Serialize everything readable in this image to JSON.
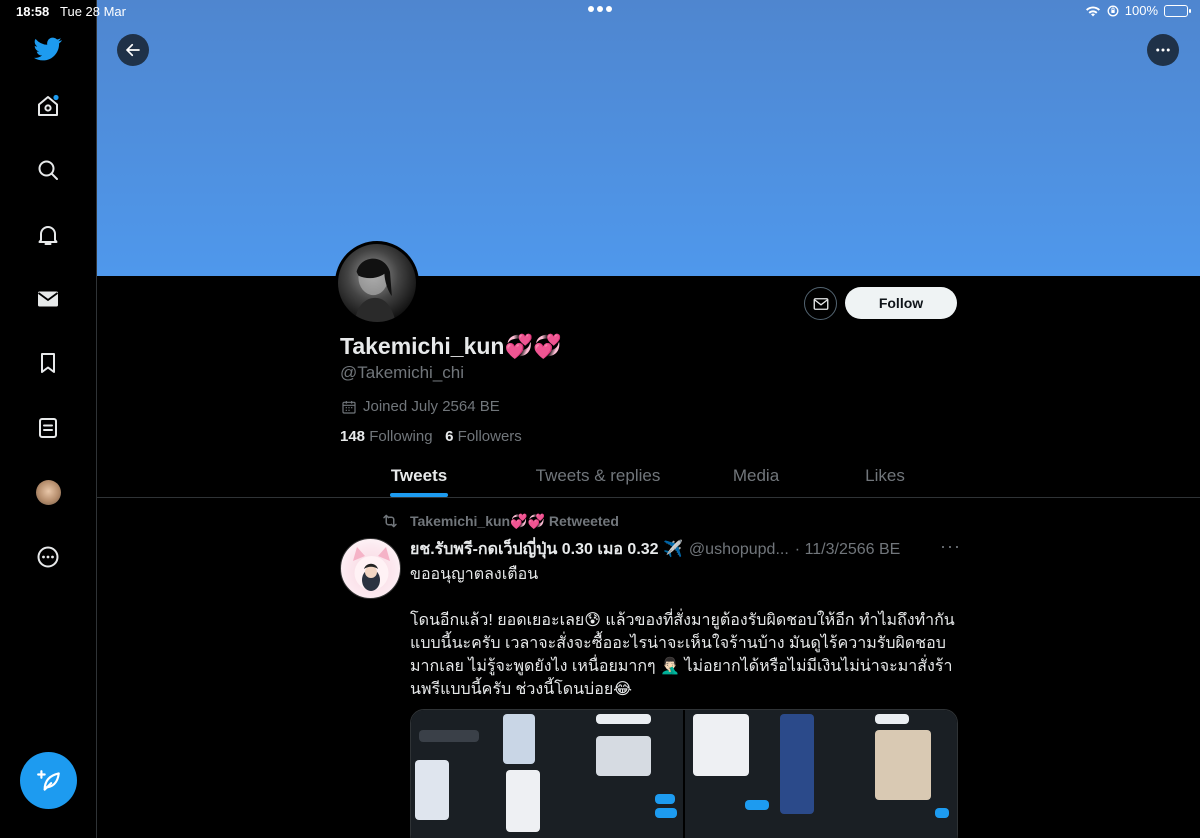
{
  "status_bar": {
    "time": "18:58",
    "date": "Tue 28 Mar",
    "battery": "100%"
  },
  "sidebar": {
    "items": [
      {
        "name": "home",
        "icon": "home-icon"
      },
      {
        "name": "explore",
        "icon": "search-icon"
      },
      {
        "name": "notifications",
        "icon": "bell-icon"
      },
      {
        "name": "messages",
        "icon": "mail-icon"
      },
      {
        "name": "bookmarks",
        "icon": "bookmark-icon"
      },
      {
        "name": "lists",
        "icon": "list-icon"
      },
      {
        "name": "profile",
        "icon": "avatar-icon"
      },
      {
        "name": "more",
        "icon": "more-circle-icon"
      }
    ],
    "compose_icon": "compose-tweet-icon"
  },
  "profile": {
    "display_name": "Takemichi_kun💞💞",
    "handle": "@Takemichi_chi",
    "joined": "Joined July 2564 BE",
    "following_count": "148",
    "following_label": "Following",
    "followers_count": "6",
    "followers_label": "Followers",
    "follow_button": "Follow"
  },
  "tabs": [
    {
      "label": "Tweets",
      "active": true
    },
    {
      "label": "Tweets & replies",
      "active": false
    },
    {
      "label": "Media",
      "active": false
    },
    {
      "label": "Likes",
      "active": false
    }
  ],
  "tweet": {
    "retweeted_by": "Takemichi_kun💞💞 Retweeted",
    "author_name": "ยช.รับพรี-กดเว็ปญี่ปุ่น 0.30 เมอ 0.32 ✈️",
    "author_handle": "@ushopupd...",
    "date": "· 11/3/2566 BE",
    "more": "···",
    "text_line1": "ขออนุญาตลงเตือน",
    "text_line2": "โดนอีกแล้ว! ยอดเยอะเลย😰 แล้วของที่สั่งมายูต้องรับผิดชอบให้อีก ทำไมถึงทำกันแบบนี้นะครับ เวลาจะสั่งจะซื้ออะไรน่าจะเห็นใจร้านบ้าง มันดูไร้ความรับผิดชอบมากเลย ไม่รู้จะพูดยังไง เหนื่อยมากๆ 🤦🏻‍♂️ ไม่อยากได้หรือไม่มีเงินไม่น่าจะมาสั่งร้านพรีแบบนี้ครับ ช่วงนี้โดนบ่อย😂"
  },
  "colors": {
    "accent": "#1d9bf0",
    "banner": "#4f90e0",
    "background": "#000000",
    "secondary_text": "#71767b"
  }
}
